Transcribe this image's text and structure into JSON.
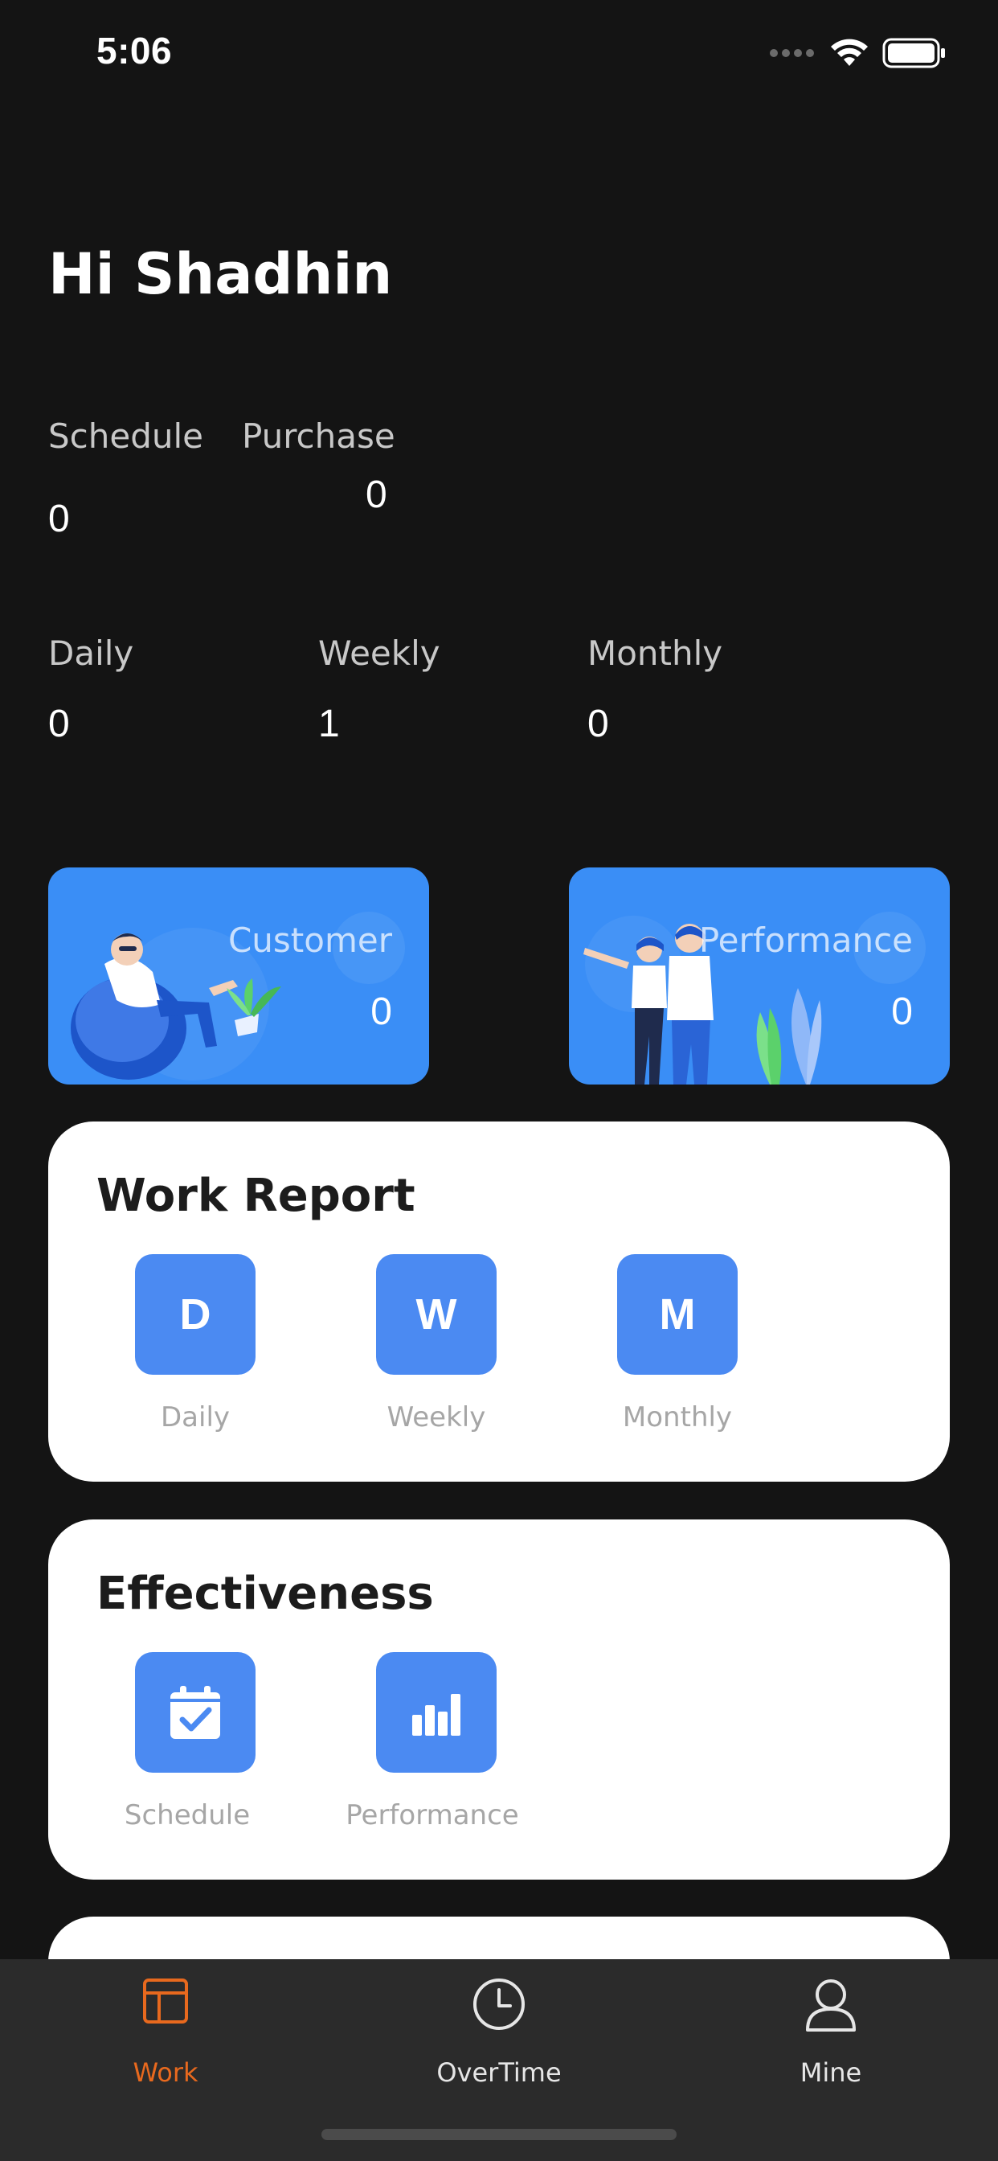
{
  "status_bar": {
    "time": "5:06",
    "icons": [
      "signal-icon",
      "wifi-icon",
      "battery-icon"
    ]
  },
  "greeting": "Hi Shadhin",
  "summary": {
    "schedule_label": "Schedule",
    "schedule_value": "0",
    "purchase_label": "Purchase",
    "purchase_value": "0"
  },
  "reports": {
    "daily_label": "Daily",
    "daily_value": "0",
    "weekly_label": "Weekly",
    "weekly_value": "1",
    "monthly_label": "Monthly",
    "monthly_value": "0"
  },
  "promo_cards": [
    {
      "title": "Customer",
      "value": "0"
    },
    {
      "title": "Performance",
      "value": "0"
    }
  ],
  "work_report": {
    "title": "Work Report",
    "items": [
      {
        "letter": "D",
        "label": "Daily"
      },
      {
        "letter": "W",
        "label": "Weekly"
      },
      {
        "letter": "M",
        "label": "Monthly"
      }
    ]
  },
  "effectiveness": {
    "title": "Effectiveness",
    "items": [
      {
        "icon": "calendar-check-icon",
        "label": "Schedule"
      },
      {
        "icon": "bar-chart-icon",
        "label": "Performance"
      }
    ]
  },
  "tab_bar": {
    "active": "Work",
    "tabs": [
      {
        "label": "Work",
        "icon": "layout-icon"
      },
      {
        "label": "OverTime",
        "icon": "clock-icon"
      },
      {
        "label": "Mine",
        "icon": "user-icon"
      }
    ]
  },
  "colors": {
    "background": "#141414",
    "accent": "#3a8ef6",
    "tile": "#4b8af2",
    "tab_active": "#e8691e",
    "tab_inactive": "#e6e6e6"
  }
}
